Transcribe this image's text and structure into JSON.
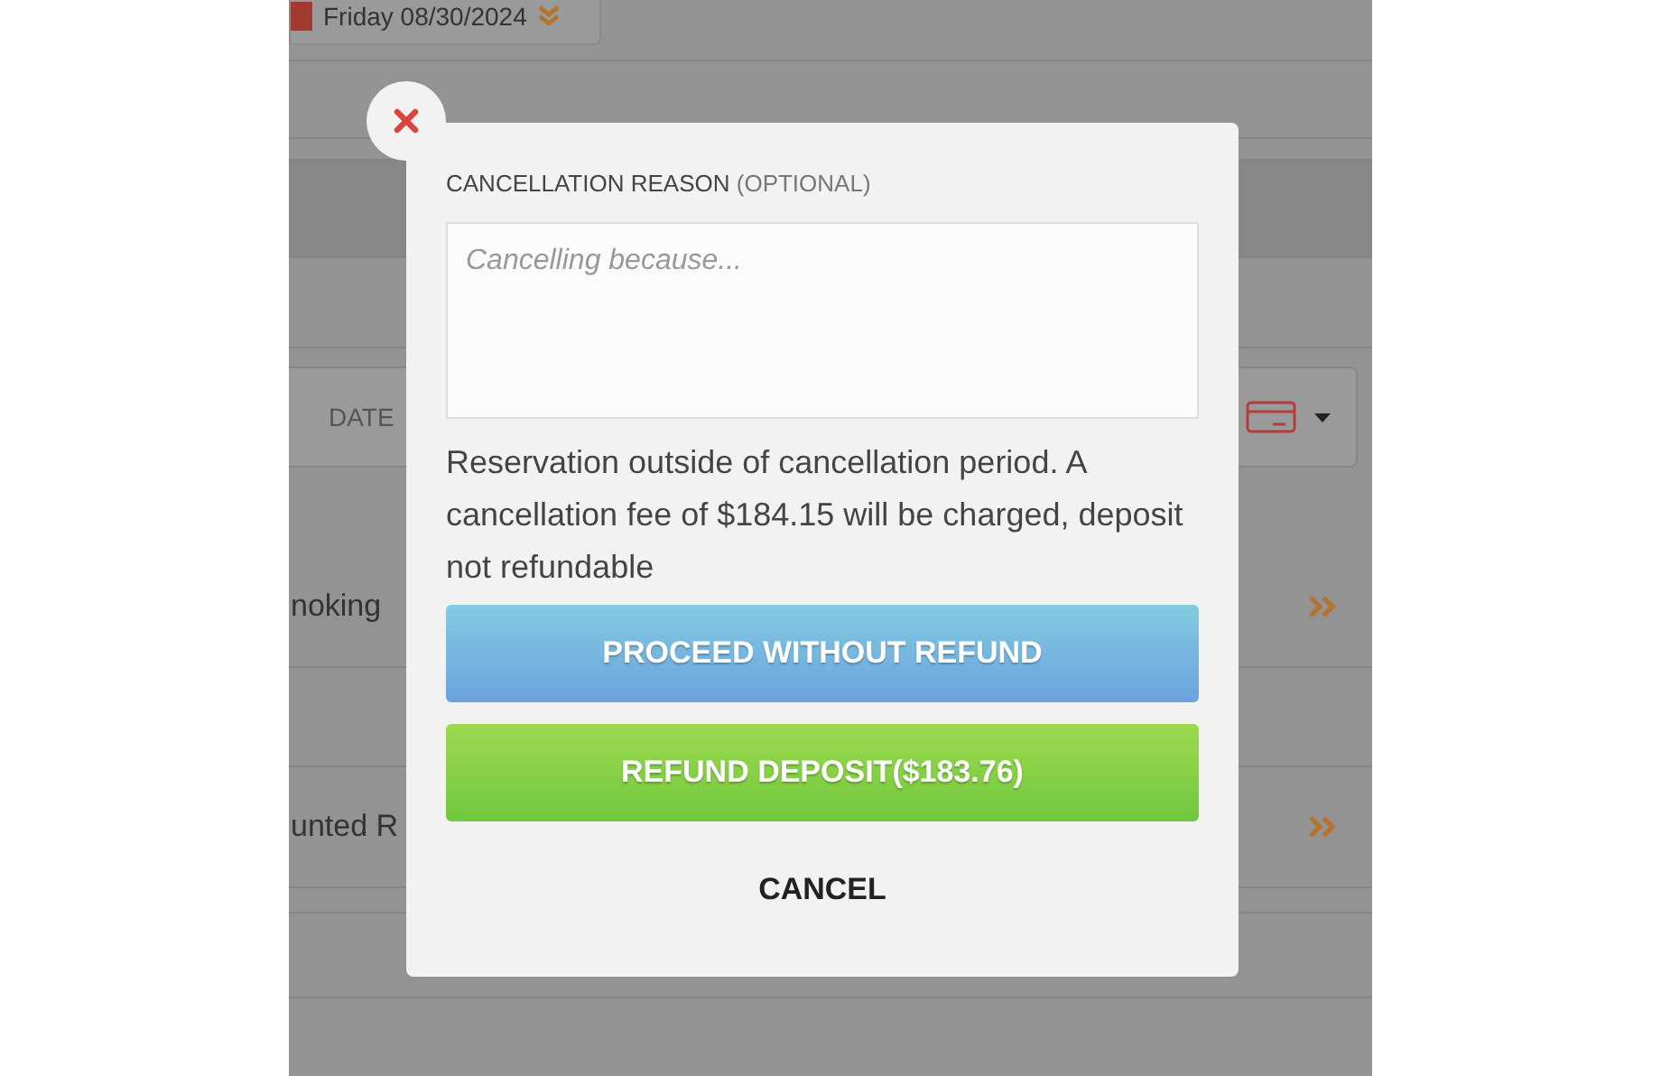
{
  "background": {
    "date": "Friday 08/30/2024",
    "date_label": "DATE",
    "rows": [
      {
        "label": "noking"
      },
      {
        "label": "unted R"
      }
    ]
  },
  "dialog": {
    "label": "CANCELLATION REASON",
    "label_note": "(OPTIONAL)",
    "placeholder": "Cancelling because...",
    "message": "Reservation outside of cancellation period. A cancellation fee of $184.15 will be charged, deposit not refundable",
    "buttons": [
      {
        "kind": "primary",
        "label": "PROCEED WITHOUT REFUND"
      },
      {
        "kind": "success",
        "label": "REFUND DEPOSIT($183.76)"
      },
      {
        "kind": "plain",
        "label": "CANCEL"
      }
    ]
  }
}
